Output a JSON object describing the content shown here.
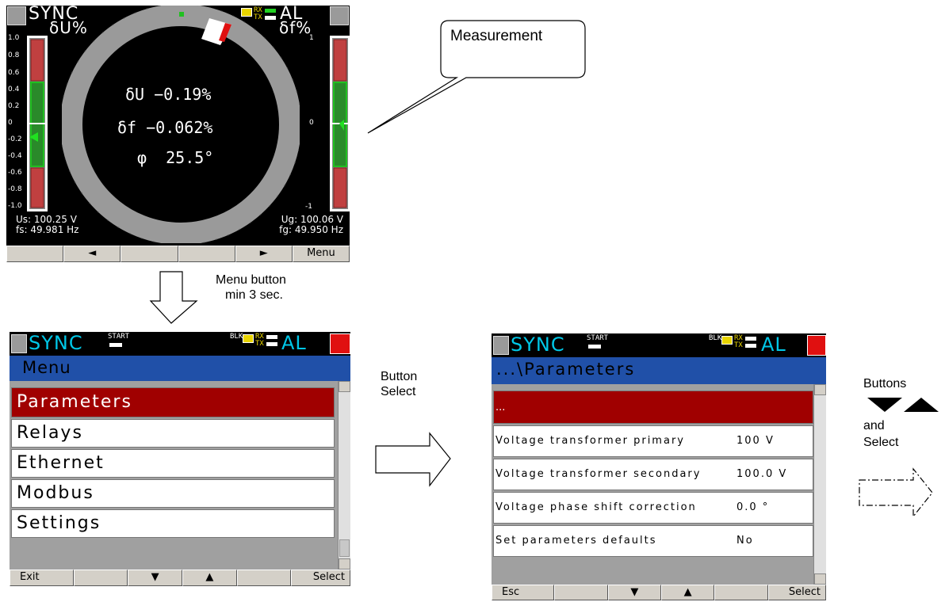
{
  "screen1": {
    "title": "SYNC",
    "alarm": "AL",
    "rx": "RX",
    "tx": "TX",
    "left_label": "δU%",
    "right_label": "δf%",
    "left_scale": [
      "1.0",
      "0.8",
      "0.6",
      "0.4",
      "0.2",
      "0",
      "-0.2",
      "-0.4",
      "-0.6",
      "-0.8",
      "-1.0"
    ],
    "right_scale_top": "1",
    "right_scale_mid": "0",
    "right_scale_bottom": "-1",
    "measurements": {
      "du": "δU −0.19%",
      "df": "δf −0.062%",
      "phi": "φ  25.5°"
    },
    "us": "Us: 100.25 V",
    "fs": "fs: 49.981 Hz",
    "ug": "Ug: 100.06 V",
    "fg": "fg: 49.950 Hz",
    "softkeys": [
      "",
      "◄",
      "",
      "",
      "►",
      "Menu"
    ]
  },
  "screen2": {
    "title": "SYNC",
    "start": "START",
    "blk": "BLK",
    "rx": "RX",
    "tx": "TX",
    "alarm": "AL",
    "header": "Menu",
    "items": [
      "Parameters",
      "Relays",
      "Ethernet",
      "Modbus",
      "Settings"
    ],
    "softkeys": [
      "Exit",
      "",
      "▼",
      "▲",
      "",
      "Select"
    ]
  },
  "screen3": {
    "title": "SYNC",
    "start": "START",
    "blk": "BLK",
    "rx": "RX",
    "tx": "TX",
    "alarm": "AL",
    "header": "...\\Parameters",
    "selected_item": "...",
    "params": [
      {
        "label": "Voltage transformer primary",
        "value": "100 V"
      },
      {
        "label": "Voltage transformer secondary",
        "value": "100.0 V"
      },
      {
        "label": "Voltage phase shift correction",
        "value": "0.0 °"
      },
      {
        "label": "Set parameters defaults",
        "value": "No"
      }
    ],
    "softkeys": [
      "Esc",
      "",
      "▼",
      "▲",
      "",
      "Select"
    ]
  },
  "annotations": {
    "callout": "Measurement",
    "menu_button_1": "Menu button",
    "menu_button_2": "min 3 sec.",
    "button_select_1": "Button",
    "button_select_2": "Select",
    "buttons": "Buttons",
    "and": "and",
    "select": "Select"
  },
  "colors": {
    "menu_title_bg": "#2050a8",
    "selected_item": "#a00000",
    "bar_red": "#c04040",
    "bar_green": "#2a8a2a",
    "alarm_red": "#e01010",
    "sync_cyan": "#00c8e8"
  }
}
